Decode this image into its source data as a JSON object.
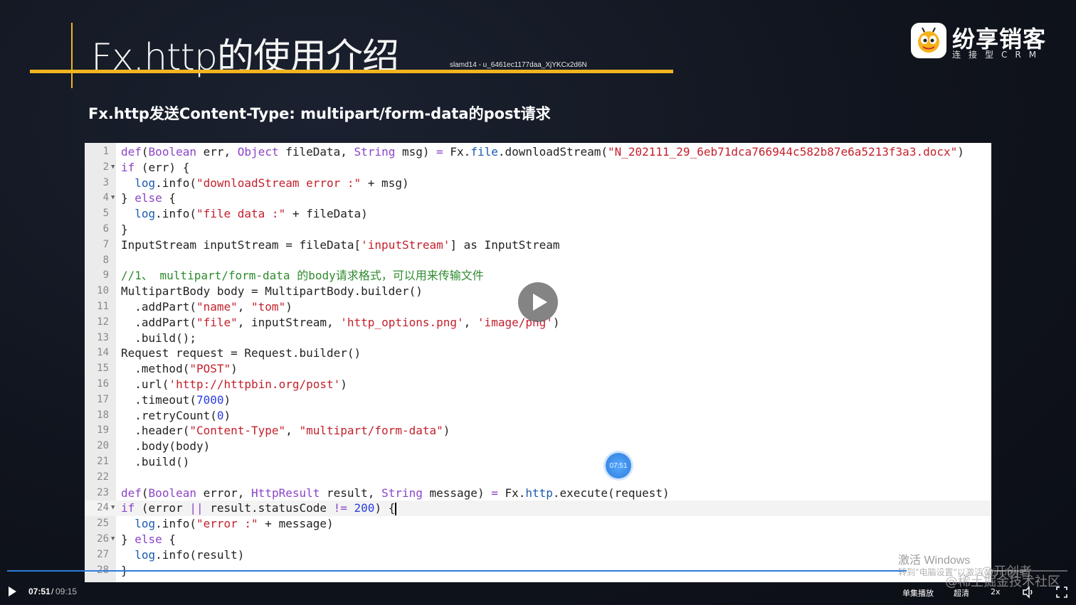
{
  "slide": {
    "title": "Fx.http的使用介绍",
    "watermark_id": "slamd14 - u_6461ec1177daa_XjYKCx2d6N",
    "subtitle": "Fx.http发送Content-Type: multipart/form-data的post请求"
  },
  "logo": {
    "name": "纷享销客",
    "tagline": "连接型CRM"
  },
  "code": {
    "lines": [
      {
        "n": "1"
      },
      {
        "n": "2"
      },
      {
        "n": "3"
      },
      {
        "n": "4"
      },
      {
        "n": "5"
      },
      {
        "n": "6"
      },
      {
        "n": "7"
      },
      {
        "n": "8"
      },
      {
        "n": "9"
      },
      {
        "n": "10"
      },
      {
        "n": "11"
      },
      {
        "n": "12"
      },
      {
        "n": "13"
      },
      {
        "n": "14"
      },
      {
        "n": "15"
      },
      {
        "n": "16"
      },
      {
        "n": "17"
      },
      {
        "n": "18"
      },
      {
        "n": "19"
      },
      {
        "n": "20"
      },
      {
        "n": "21"
      },
      {
        "n": "22"
      },
      {
        "n": "23"
      },
      {
        "n": "24"
      },
      {
        "n": "25"
      },
      {
        "n": "26"
      },
      {
        "n": "27"
      },
      {
        "n": "28"
      }
    ],
    "t": {
      "l1_def": "def",
      "l1_open": "(",
      "l1_bool": "Boolean",
      "l1_err": " err, ",
      "l1_obj": "Object",
      "l1_fd": " fileData, ",
      "l1_string": "String",
      "l1_msg": " msg) ",
      "l1_eq": "=",
      "l1_fx": " Fx.",
      "l1_file": "file",
      "l1_dl": ".downloadStream(",
      "l1_str": "\"N_202111_29_6eb71dca766944c582b87e6a5213f3a3.docx\"",
      "l1_close": ")",
      "l2_if": "if",
      "l2_rest": " (err) {",
      "l3_log": "log",
      "l3_info": ".info(",
      "l3_str": "\"downloadStream error :\"",
      "l3_rest": " + msg)",
      "l4_close": "} ",
      "l4_else": "else",
      "l4_rest": " {",
      "l5_log": "log",
      "l5_info": ".info(",
      "l5_str": "\"file data :\"",
      "l5_rest": " + fileData)",
      "l6": "}",
      "l7_a": "InputStream inputStream = fileData[",
      "l7_str": "'inputStream'",
      "l7_b": "] as InputStream",
      "l9_cmt": "//1、 multipart/form-data 的body请求格式，可以用来传输文件",
      "l10": "MultipartBody body = MultipartBody.builder()",
      "l11_a": "  .addPart(",
      "l11_s1": "\"name\"",
      "l11_c": ", ",
      "l11_s2": "\"tom\"",
      "l11_b": ")",
      "l12_a": "  .addPart(",
      "l12_s1": "\"file\"",
      "l12_c": ", inputStream, ",
      "l12_s2": "'http_options.png'",
      "l12_c2": ", ",
      "l12_s3": "'image/png'",
      "l12_b": ")",
      "l13": "  .build();",
      "l14": "Request request = Request.builder()",
      "l15_a": "  .method(",
      "l15_s": "\"POST\"",
      "l15_b": ")",
      "l16_a": "  .url(",
      "l16_s": "'http://httpbin.org/post'",
      "l16_b": ")",
      "l17_a": "  .timeout(",
      "l17_n": "7000",
      "l17_b": ")",
      "l18_a": "  .retryCount(",
      "l18_n": "0",
      "l18_b": ")",
      "l19_a": "  .header(",
      "l19_s1": "\"Content-Type\"",
      "l19_c": ", ",
      "l19_s2": "\"multipart/form-data\"",
      "l19_b": ")",
      "l20": "  .body(body)",
      "l21": "  .build()",
      "l23_def": "def",
      "l23_open": "(",
      "l23_bool": "Boolean",
      "l23_err": " error, ",
      "l23_hr": "HttpResult",
      "l23_res": " result, ",
      "l23_string": "String",
      "l23_msg": " message) ",
      "l23_eq": "=",
      "l23_fx": " Fx.",
      "l23_http": "http",
      "l23_exec": ".execute(request)",
      "l24_if": "if",
      "l24_a": " (error ",
      "l24_or": "||",
      "l24_b": " result.statusCode ",
      "l24_ne": "!=",
      "l24_sp": " ",
      "l24_n": "200",
      "l24_c": ") {",
      "l25_log": "  log",
      "l25_info": ".info(",
      "l25_str": "\"error :\"",
      "l25_rest": " + message)",
      "l26_close": "} ",
      "l26_else": "else",
      "l26_rest": " {",
      "l27_log": "  log",
      "l27_rest": ".info(result)",
      "l28": "}"
    }
  },
  "player": {
    "bubble_time": "07:51",
    "current_time": "07:51",
    "separator": "/",
    "total_time": "09:15",
    "progress_fraction": 0.848,
    "single_play_label": "单集播放",
    "quality_label": "超清",
    "speed_label": "2x"
  },
  "overlays": {
    "windows_activate": "激活 Windows",
    "windows_activate_hint": "转到\"电脑设置\"以激活 Windows。",
    "author": "@开创者",
    "community": "@稀土掘金技术社区"
  },
  "colors": {
    "accent": "#f2b520",
    "progress": "#2f7ddc",
    "keyword": "#8b44c8",
    "string": "#c4202c",
    "number": "#2a3de0",
    "comment": "#2e8b2e"
  }
}
